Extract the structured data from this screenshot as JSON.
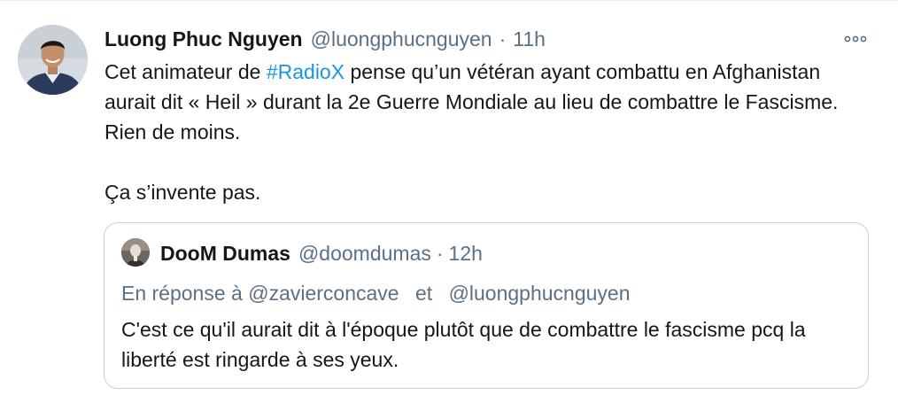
{
  "tweet": {
    "display_name": "Luong Phuc Nguyen",
    "handle": "@luongphucnguyen",
    "separator": "·",
    "time": "11h",
    "text_line1_before": "Cet animateur de ",
    "hashtag": "#RadioX",
    "text_line1_after": " pense qu’un vétéran ayant combattu en Afghanistan aurait dit « Heil » durant la 2e Guerre Mondiale au lieu de combattre le Fascisme. Rien de moins.",
    "text_para2": "Ça s’invente pas.",
    "more_icon": "ellipsis-icon",
    "avatar_icon": "profile-photo"
  },
  "quoted_tweet": {
    "display_name": "DooM Dumas",
    "handle": "@doomdumas",
    "separator": "·",
    "time": "12h",
    "reply_prefix": "En réponse à",
    "reply_to_1": "@zavierconcave",
    "reply_and": "et",
    "reply_to_2": "@luongphucnguyen",
    "text": "C'est ce qu'il aurait dit à l'époque plutôt que de combattre le fascisme pcq la liberté est ringarde à ses yeux.",
    "avatar_icon": "profile-photo"
  },
  "colors": {
    "link": "#1b95e0",
    "secondary_text": "#5b7083",
    "primary_text": "#14171a",
    "quote_border": "#c4cfd6"
  }
}
